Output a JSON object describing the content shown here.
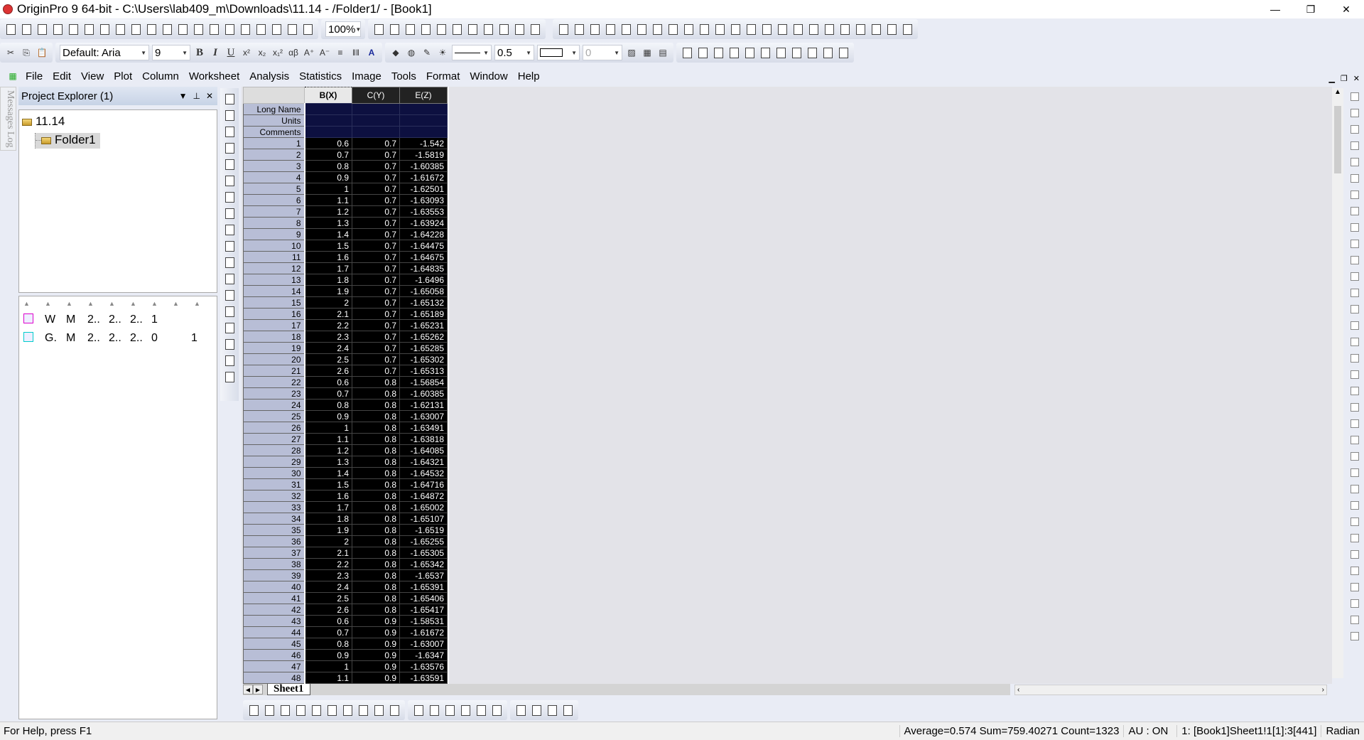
{
  "window": {
    "title": "OriginPro 9 64-bit - C:\\Users\\lab409_m\\Downloads\\11.14 - /Folder1/ - [Book1]",
    "minimize": "—",
    "restore": "❐",
    "close": "✕"
  },
  "toolbar1": {
    "zoom": "100%",
    "icons": [
      "new-project-icon",
      "new-folder-icon",
      "new-worksheet-icon",
      "new-excel-icon",
      "new-graph-icon",
      "new-matrix-icon",
      "new-function-icon",
      "new-layout-icon",
      "new-notes-icon",
      "new-3d-icon",
      "open-icon",
      "open-template-icon",
      "open-excel-icon",
      "save-icon",
      "save-template-icon",
      "import-ascii-icon",
      "import-multiple-icon",
      "import-wizard-icon",
      "recalculate-icon",
      "batch-icon"
    ],
    "icons2": [
      "print-icon",
      "slide-show-icon",
      "copy-page-icon",
      "video-icon",
      "code-builder-icon",
      "results-log-icon",
      "project-explorer-icon",
      "object-manager-icon",
      "command-window-icon",
      "apps-icon",
      "add-column-icon"
    ],
    "icons3": [
      "sum-icon",
      "stats-icon",
      "sort-icon",
      "xy-icon",
      "table-icon",
      "column-chart-icon",
      "bar-chart-icon",
      "chart-3-icon",
      "filter-icon",
      "filter-clear-icon",
      "filter-more-icon",
      "set-x-icon",
      "set-y-icon",
      "set-z-icon",
      "set-error-icon",
      "label-icon",
      "none-icon",
      "set-group-icon",
      "set-subject-icon",
      "first-icon",
      "prev-icon",
      "next-icon",
      "last-icon"
    ]
  },
  "toolbar2": {
    "font": "Default: Aria",
    "font_size": "9",
    "bold": "B",
    "italic": "I",
    "underline": "U",
    "line_width": "0.5",
    "pattern_value": "0"
  },
  "menu": [
    "File",
    "Edit",
    "View",
    "Plot",
    "Column",
    "Worksheet",
    "Analysis",
    "Statistics",
    "Image",
    "Tools",
    "Format",
    "Window",
    "Help"
  ],
  "messages_log": "Messages Log",
  "project_explorer": {
    "title": "Project Explorer (1)",
    "root": "11.14",
    "folder": "Folder1",
    "items": [
      [
        "W",
        "M",
        "2..",
        "2..",
        "2..",
        "1",
        ""
      ],
      [
        "G.",
        "M",
        "2..",
        "2..",
        "2..",
        "0",
        "1"
      ]
    ]
  },
  "worksheet": {
    "columns": [
      "B(X)",
      "C(Y)",
      "E(Z)"
    ],
    "labels": [
      "Long Name",
      "Units",
      "Comments"
    ],
    "rows": [
      [
        "0.6",
        "0.7",
        "-1.542"
      ],
      [
        "0.7",
        "0.7",
        "-1.5819"
      ],
      [
        "0.8",
        "0.7",
        "-1.60385"
      ],
      [
        "0.9",
        "0.7",
        "-1.61672"
      ],
      [
        "1",
        "0.7",
        "-1.62501"
      ],
      [
        "1.1",
        "0.7",
        "-1.63093"
      ],
      [
        "1.2",
        "0.7",
        "-1.63553"
      ],
      [
        "1.3",
        "0.7",
        "-1.63924"
      ],
      [
        "1.4",
        "0.7",
        "-1.64228"
      ],
      [
        "1.5",
        "0.7",
        "-1.64475"
      ],
      [
        "1.6",
        "0.7",
        "-1.64675"
      ],
      [
        "1.7",
        "0.7",
        "-1.64835"
      ],
      [
        "1.8",
        "0.7",
        "-1.6496"
      ],
      [
        "1.9",
        "0.7",
        "-1.65058"
      ],
      [
        "2",
        "0.7",
        "-1.65132"
      ],
      [
        "2.1",
        "0.7",
        "-1.65189"
      ],
      [
        "2.2",
        "0.7",
        "-1.65231"
      ],
      [
        "2.3",
        "0.7",
        "-1.65262"
      ],
      [
        "2.4",
        "0.7",
        "-1.65285"
      ],
      [
        "2.5",
        "0.7",
        "-1.65302"
      ],
      [
        "2.6",
        "0.7",
        "-1.65313"
      ],
      [
        "0.6",
        "0.8",
        "-1.56854"
      ],
      [
        "0.7",
        "0.8",
        "-1.60385"
      ],
      [
        "0.8",
        "0.8",
        "-1.62131"
      ],
      [
        "0.9",
        "0.8",
        "-1.63007"
      ],
      [
        "1",
        "0.8",
        "-1.63491"
      ],
      [
        "1.1",
        "0.8",
        "-1.63818"
      ],
      [
        "1.2",
        "0.8",
        "-1.64085"
      ],
      [
        "1.3",
        "0.8",
        "-1.64321"
      ],
      [
        "1.4",
        "0.8",
        "-1.64532"
      ],
      [
        "1.5",
        "0.8",
        "-1.64716"
      ],
      [
        "1.6",
        "0.8",
        "-1.64872"
      ],
      [
        "1.7",
        "0.8",
        "-1.65002"
      ],
      [
        "1.8",
        "0.8",
        "-1.65107"
      ],
      [
        "1.9",
        "0.8",
        "-1.6519"
      ],
      [
        "2",
        "0.8",
        "-1.65255"
      ],
      [
        "2.1",
        "0.8",
        "-1.65305"
      ],
      [
        "2.2",
        "0.8",
        "-1.65342"
      ],
      [
        "2.3",
        "0.8",
        "-1.6537"
      ],
      [
        "2.4",
        "0.8",
        "-1.65391"
      ],
      [
        "2.5",
        "0.8",
        "-1.65406"
      ],
      [
        "2.6",
        "0.8",
        "-1.65417"
      ],
      [
        "0.6",
        "0.9",
        "-1.58531"
      ],
      [
        "0.7",
        "0.9",
        "-1.61672"
      ],
      [
        "0.8",
        "0.9",
        "-1.63007"
      ],
      [
        "0.9",
        "0.9",
        "-1.6347"
      ],
      [
        "1",
        "0.9",
        "-1.63576"
      ],
      [
        "1.1",
        "0.9",
        "-1.63591"
      ]
    ],
    "sheet_tab": "Sheet1"
  },
  "status": {
    "help": "For Help, press F1",
    "stats": "Average=0.574 Sum=759.40271 Count=1323",
    "au": "AU : ON",
    "cell": "1: [Book1]Sheet1!1[1]:3[441]",
    "angle": "Radian"
  }
}
